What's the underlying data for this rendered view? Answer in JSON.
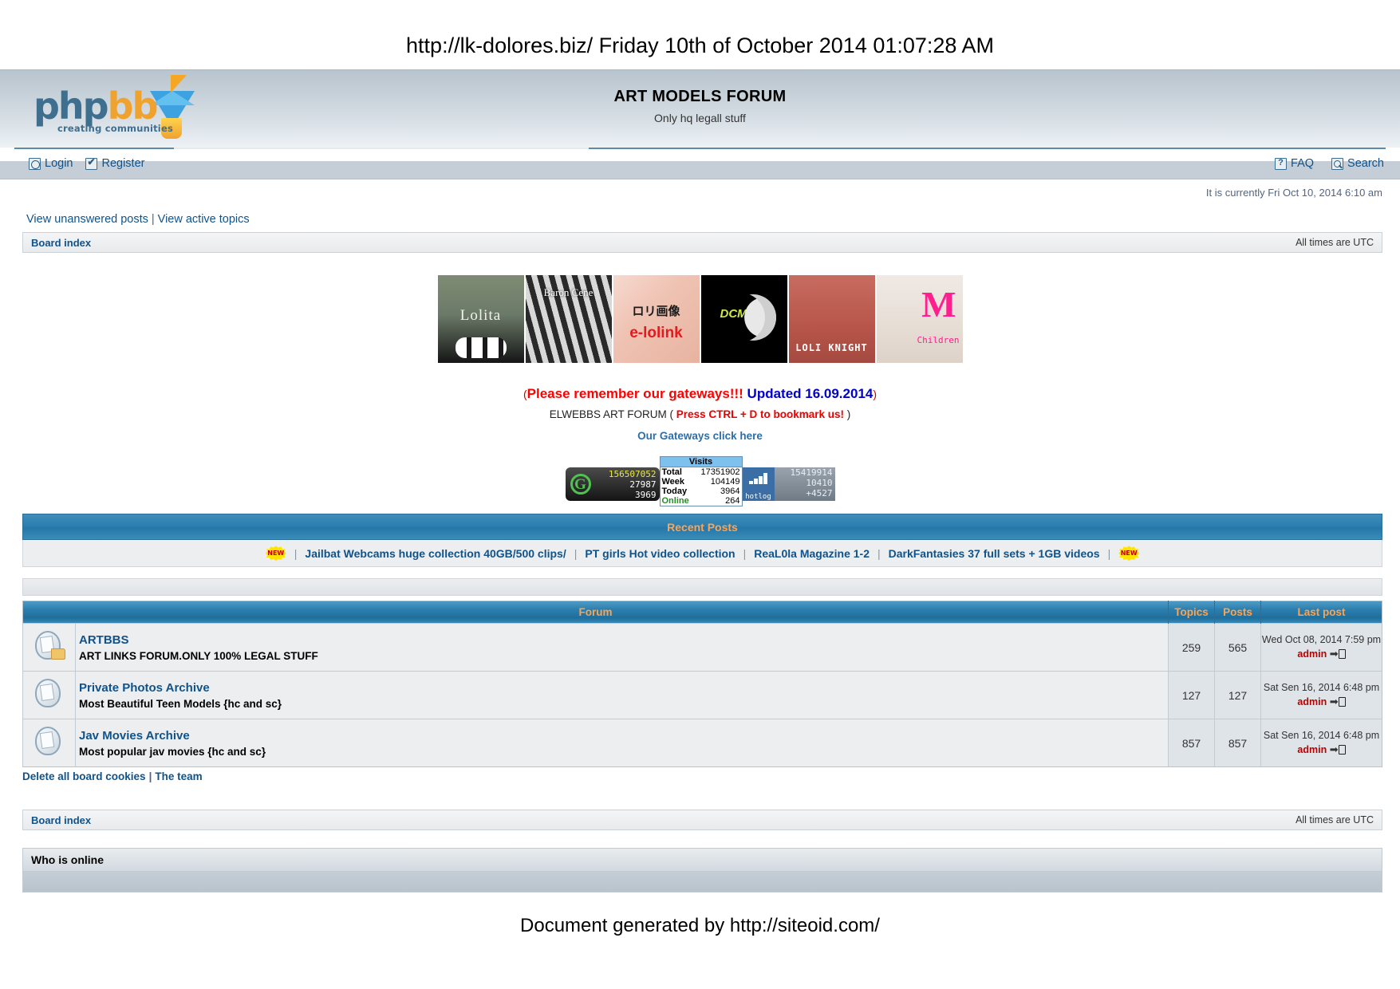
{
  "document": {
    "url_line": "http://lk-dolores.biz/ Friday 10th of October 2014 01:07:28 AM",
    "generated_by": "Document generated by http://siteoid.com/"
  },
  "header": {
    "logo_php": "php",
    "logo_bb": "bb",
    "logo_tagline": "creating communities",
    "site_title": "ART MODELS FORUM",
    "site_description": "Only hq legall stuff"
  },
  "navbar": {
    "left": [
      {
        "label": "Login",
        "icon": "login-icon"
      },
      {
        "label": "Register",
        "icon": "register-icon"
      }
    ],
    "right": [
      {
        "label": "FAQ",
        "icon": "faq-icon"
      },
      {
        "label": "Search",
        "icon": "search-icon"
      }
    ]
  },
  "status": {
    "current_time": "It is currently Fri Oct 10, 2014 6:10 am"
  },
  "quicklinks": {
    "unanswered": "View unanswered posts",
    "separator": "|",
    "active": "View active topics"
  },
  "breadcrumb": {
    "board_index": "Board index",
    "timezone": "All times are UTC"
  },
  "banners": [
    {
      "name": "lolita-banner",
      "caption": "Lolita"
    },
    {
      "name": "baron-cene-banner",
      "caption": "Baron Cene"
    },
    {
      "name": "e-lolink-banner",
      "caption_top": "ロリ画像",
      "caption_main": "e-lolink"
    },
    {
      "name": "dcmism-banner",
      "caption": "DCMism"
    },
    {
      "name": "loli-knight-banner",
      "caption": "LOLI KNIGHT"
    },
    {
      "name": "m-children-banner",
      "caption_big": "M",
      "caption_small": "Children"
    }
  ],
  "gateway": {
    "line1_open": "(",
    "line1_red": "Please remember our gateways!!!",
    "line1_blue": "Updated 16.09.2014",
    "line1_close": ")",
    "line2_prefix": "ELWEBBS ART FORUM (",
    "line2_bold": "Press CTRL + D to bookmark us!",
    "line2_suffix": ")",
    "line3": "Our Gateways click here"
  },
  "counters": {
    "left": {
      "name": "G",
      "total": "156507052",
      "second": "27987",
      "third": "3969"
    },
    "middle": {
      "title": "Visits",
      "rows": [
        {
          "label": "Total",
          "value": "17351902"
        },
        {
          "label": "Week",
          "value": "104149"
        },
        {
          "label": "Today",
          "value": "3964"
        },
        {
          "label": "Online",
          "value": "264"
        }
      ]
    },
    "right": {
      "name": "hotlog",
      "total": "15419914",
      "second": "10410",
      "third": "+4527"
    }
  },
  "recent_posts": {
    "title": "Recent Posts",
    "badge": "NEW",
    "links": [
      "Jailbat Webcams huge collection 40GB/500 clips/",
      "PT girls Hot video collection",
      "ReaL0la Magazine 1-2",
      "DarkFantasies 37 full sets + 1GB videos"
    ]
  },
  "forum_table": {
    "headers": {
      "forum": "Forum",
      "topics": "Topics",
      "posts": "Posts",
      "last_post": "Last post"
    },
    "rows": [
      {
        "title": "ARTBBS",
        "description": "ART LINKS FORUM.ONLY 100% LEGAL STUFF",
        "topics": "259",
        "posts": "565",
        "last_post_date": "Wed Oct 08, 2014 7:59 pm",
        "last_post_author": "admin"
      },
      {
        "title": "Private Photos Archive",
        "description": "Most Beautiful Teen Models {hc and sc}",
        "topics": "127",
        "posts": "127",
        "last_post_date": "Sat Sen 16, 2014 6:48 pm",
        "last_post_author": "admin"
      },
      {
        "title": "Jav Movies Archive",
        "description": "Most popular jav movies {hc and sc}",
        "topics": "857",
        "posts": "857",
        "last_post_date": "Sat Sen 16, 2014 6:48 pm",
        "last_post_author": "admin"
      }
    ]
  },
  "footer": {
    "delete_cookies": "Delete all board cookies",
    "separator": "|",
    "the_team": "The team",
    "board_index": "Board index",
    "timezone": "All times are UTC",
    "who_is_online": "Who is online"
  },
  "colors": {
    "link": "#105289",
    "header_accent": "#ffa34f",
    "table_header_bg": "#2b7faf",
    "alert_red": "#ff0000",
    "alert_blue": "#0000cd"
  }
}
